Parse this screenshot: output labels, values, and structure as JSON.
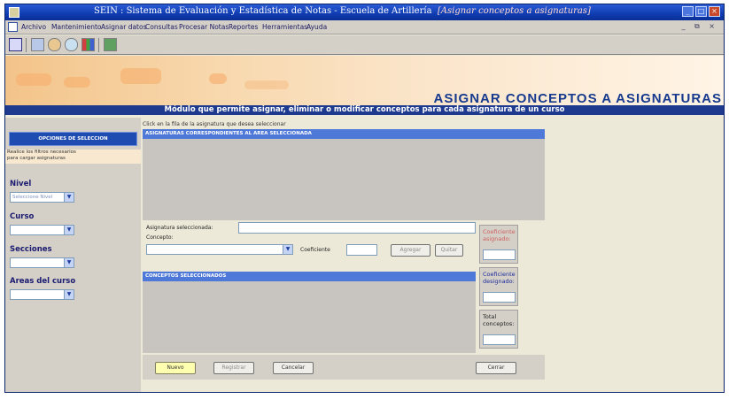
{
  "window": {
    "app_name": "SEIN : Sistema de Evaluación y Estadística de Notas",
    "separator": " - ",
    "org_name": "Escuela de Artillería",
    "window_name": "[Asignar conceptos a asignaturas]",
    "controls": [
      "_",
      "□",
      "×"
    ]
  },
  "menu": {
    "items": [
      "Archivo",
      "Mantenimiento",
      "Asignar datos",
      "Consultas",
      "Procesar Notas",
      "Reportes",
      "Herramientas",
      "Ayuda"
    ],
    "mdi_controls": "_ ⧉ ×"
  },
  "toolbar": {
    "icons": [
      "grid-icon",
      "monitor-icon",
      "gear-icon",
      "search-icon",
      "books-icon",
      "tree-icon"
    ]
  },
  "banner": {
    "title": "ASIGNAR CONCEPTOS A ASIGNATURAS",
    "subtitle": "Módulo que permite asignar, eliminar o modificar conceptos para cada asignatura de un curso"
  },
  "left_panel": {
    "header": "OPCIONES DE SELECCION",
    "note_line1": "Realice los filtros necesarios",
    "note_line2": "para cargar asignaturas",
    "filters": [
      {
        "label": "Nivel",
        "value": "Seleccione Nivel"
      },
      {
        "label": "Curso",
        "value": ""
      },
      {
        "label": "Secciones",
        "value": ""
      },
      {
        "label": "Areas del curso",
        "value": ""
      }
    ]
  },
  "main": {
    "instruction": "Click en la fila de la asignatura que desea seleccionar",
    "subjects_header": "ASIGNATURAS CORRESPONDIENTES AL AREA SELECCIONADA",
    "selected_subject_label": "Asignatura seleccionada:",
    "selected_subject_value": "",
    "concept_label": "Concepto:",
    "concept_value": "",
    "coefficient_label": "Coeficiente",
    "coefficient_value": "",
    "add_button": "Agregar",
    "remove_button": "Quitar",
    "concepts_header": "CONCEPTOS SELECCIONADOS"
  },
  "coefficients": {
    "assigned_label": "Coeficiente asignado:",
    "designated_label": "Coeficiente designado:",
    "total_label": "Total conceptos:",
    "assigned_value": "",
    "designated_value": "",
    "total_value": ""
  },
  "buttons": {
    "new": "Nuevo",
    "register": "Registrar",
    "cancel": "Cancelar",
    "close": "Cerrar"
  },
  "colors": {
    "title_bar": "#0f3cb0",
    "section_header": "#4f79d8",
    "banner_text": "#173a8e",
    "new_button": "#ffffb0"
  }
}
